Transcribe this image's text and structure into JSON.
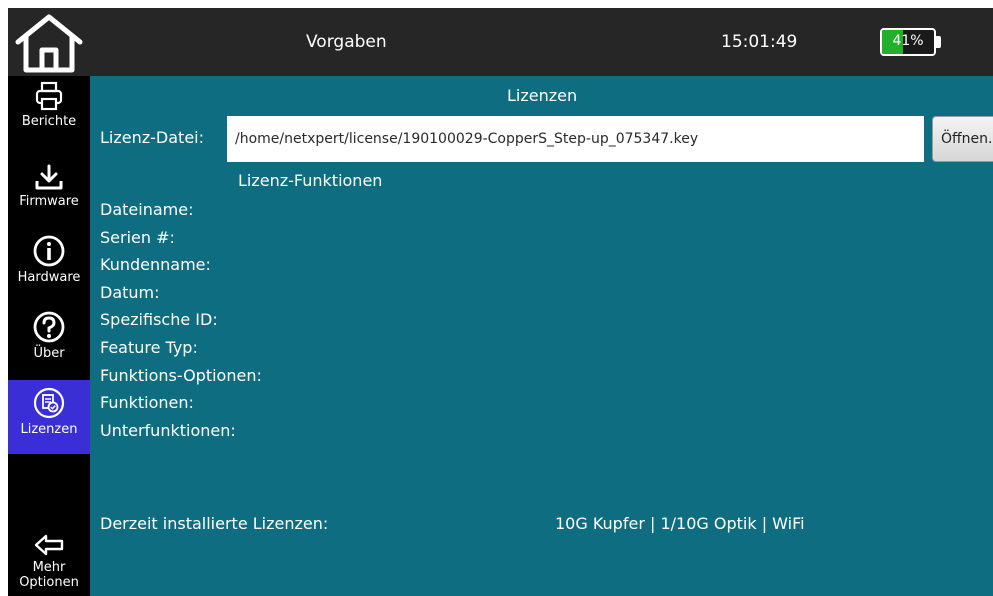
{
  "topbar": {
    "title": "Vorgaben",
    "time": "15:01:49",
    "battery": {
      "percent_label": "41%",
      "level": 0.41,
      "fill_color": "#22b02a"
    }
  },
  "sidebar": {
    "items": [
      {
        "label": "Berichte",
        "icon": "printer-icon"
      },
      {
        "label": "Firmware",
        "icon": "download-icon"
      },
      {
        "label": "Hardware",
        "icon": "info-icon"
      },
      {
        "label": "Über",
        "icon": "help-icon"
      },
      {
        "label": "Lizenzen",
        "icon": "license-icon",
        "active": true
      },
      {
        "label": "Mehr Optionen",
        "icon": "back-arrow-icon"
      }
    ],
    "active_color": "#3a2fd6"
  },
  "main": {
    "section_title": "Lizenzen",
    "file_label": "Lizenz-Datei:",
    "file_value": "/home/netxpert/license/190100029-CopperS_Step-up_075347.key",
    "open_button": "Öffnen...",
    "functions_heading": "Lizenz-Funktionen",
    "fields": [
      "Dateiname:",
      "Serien #:",
      "Kundenname:",
      "Datum:",
      "Spezifische ID:",
      "Feature Typ:",
      "Funktions-Optionen:",
      "Funktionen:",
      "Unterfunktionen:"
    ],
    "installed_label": "Derzeit installierte Lizenzen:",
    "installed_value": "10G Kupfer | 1/10G Optik | WiFi"
  },
  "colors": {
    "content_bg": "#0e6d80",
    "topbar_bg": "#262626",
    "sidebar_bg": "#000000"
  }
}
